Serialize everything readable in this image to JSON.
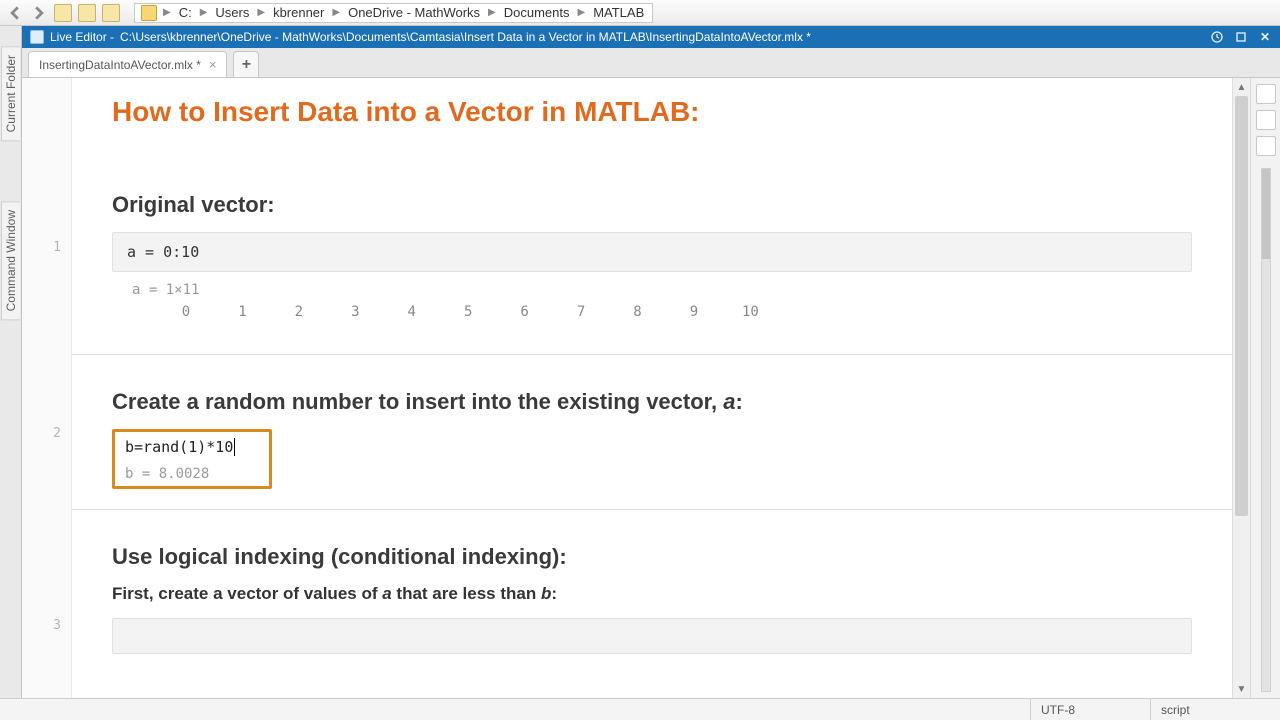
{
  "breadcrumb": [
    "C:",
    "Users",
    "kbrenner",
    "OneDrive - MathWorks",
    "Documents",
    "MATLAB"
  ],
  "editor": {
    "title_prefix": "Live Editor - ",
    "title_path": "C:\\Users\\kbrenner\\OneDrive - MathWorks\\Documents\\Camtasia\\Insert Data in a Vector in MATLAB\\InsertingDataIntoAVector.mlx *"
  },
  "tab": {
    "label": "InsertingDataIntoAVector.mlx *"
  },
  "doc": {
    "title": "How to Insert Data into a Vector in MATLAB:",
    "sec1": "Original vector:",
    "code1": "a = 0:10",
    "out1_label": "a = 1×11",
    "out1_vals": [
      "0",
      "1",
      "2",
      "3",
      "4",
      "5",
      "6",
      "7",
      "8",
      "9",
      "10"
    ],
    "sec2_a": "Create a random number to insert into the existing vector, ",
    "sec2_b": "a",
    "sec2_c": ":",
    "code2": "b=rand(1)*10",
    "out2": "b = 8.0028",
    "sec3": "Use logical indexing (conditional indexing):",
    "sub3_a": "First, create a vector of values of ",
    "sub3_b": "a",
    "sub3_c": " that are less than ",
    "sub3_d": "b",
    "sub3_e": ":"
  },
  "lines": {
    "l1": "1",
    "l2": "2",
    "l3": "3"
  },
  "sidetabs": {
    "folder": "Current Folder",
    "cmd": "Command Window"
  },
  "status": {
    "enc": "UTF-8",
    "mode": "script"
  }
}
